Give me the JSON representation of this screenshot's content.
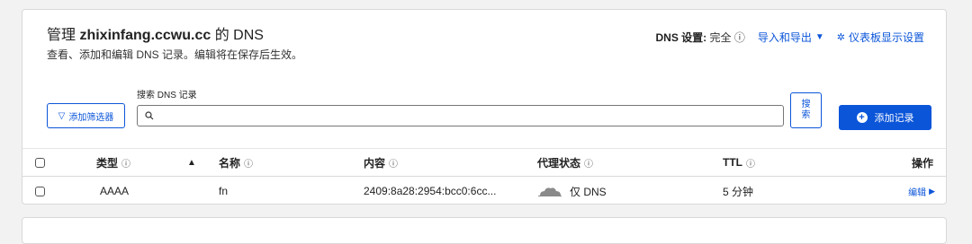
{
  "header": {
    "title_prefix": "管理 ",
    "domain": "zhixinfang.ccwu.cc",
    "title_suffix": " 的 DNS",
    "subtitle": "查看、添加和编辑 DNS 记录。编辑将在保存后生效。",
    "dns_setting_label": "DNS 设置:",
    "dns_setting_value": " 完全 ⓘ",
    "import_export": "导入和导出",
    "dashboard_settings": "仪表板显示设置"
  },
  "toolbar": {
    "filter_label": "添加筛选器",
    "search_label": "搜索 DNS 记录",
    "search_placeholder": "",
    "search_button": "搜\n索",
    "add_record": "添加记录"
  },
  "table": {
    "headers": {
      "type": "类型",
      "name": "名称",
      "content": "内容",
      "proxy": "代理状态",
      "ttl": "TTL",
      "actions": "操作"
    },
    "rows": [
      {
        "type": "AAAA",
        "name": "fn",
        "content": "2409:8a28:2954:bcc0:6cc...",
        "proxy": "仅 DNS",
        "ttl": "5 分钟",
        "action": "编辑"
      }
    ]
  },
  "colors": {
    "accent": "#0b55d9"
  }
}
